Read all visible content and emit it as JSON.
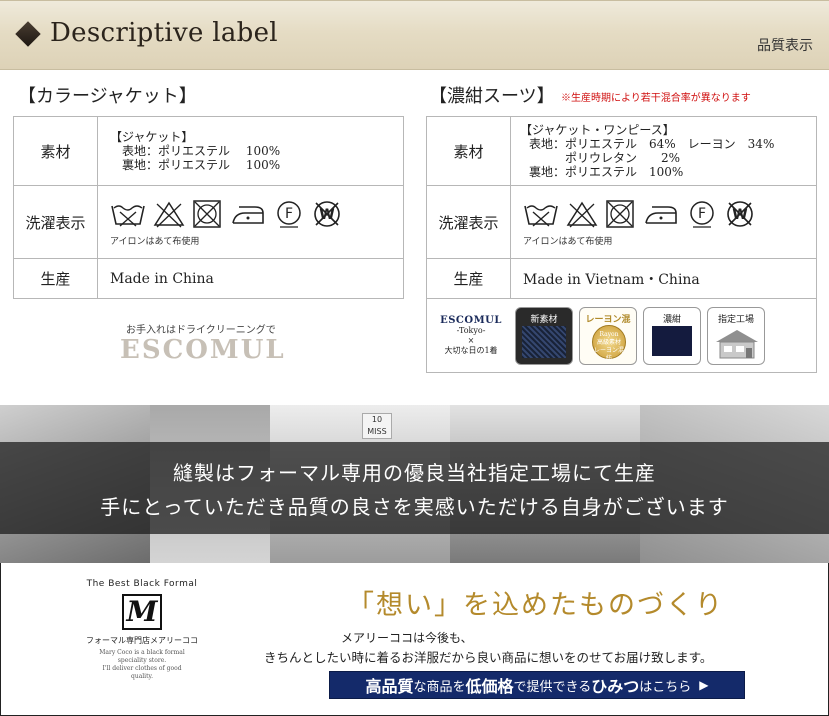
{
  "header": {
    "title": "Descriptive label",
    "subtitle": "品質表示"
  },
  "left": {
    "section_title": "【カラージャケット】",
    "rows": {
      "material_label": "素材",
      "material_head": "【ジャケット】",
      "material_lines": [
        "表地：ポリエステル　 100%",
        "裏地：ポリエステル　 100%"
      ],
      "care_label": "洗濯表示",
      "care_caption": "アイロンはあて布使用",
      "production_label": "生産",
      "production_value": "Made in China"
    },
    "cleaning_note": "お手入れはドライクリーニングで",
    "logo": "ESCOMUL"
  },
  "right": {
    "section_title": "【濃紺スーツ】",
    "note": "※生産時期により若干混合率が異なります",
    "rows": {
      "material_label": "素材",
      "material_head": "【ジャケット・ワンピース】",
      "material_lines": [
        "表地：ポリエステル　64%　レーヨン　34%",
        "　　　ポリウレタン　　2%",
        "裏地：ポリエステル　100%"
      ],
      "care_label": "洗濯表示",
      "care_caption": "アイロンはあて布使用",
      "production_label": "生産",
      "production_value": "Made in Vietnam・China"
    },
    "badges": {
      "brand_line1": "ESCOMUL",
      "brand_line2": "-Tokyo-",
      "brand_line3": "×",
      "brand_line4": "大切な日の1着",
      "new_material": "新素材",
      "rayon_mix": "レーヨン混",
      "rayon_medal_1": "Rayon",
      "rayon_medal_2": "高級素材",
      "rayon_medal_3": "レーヨン混紡",
      "navy": "濃紺",
      "factory": "指定工場"
    }
  },
  "banner": {
    "line1": "縫製はフォーマル専用の優良当社指定工場にて生産",
    "line2": "手にとっていただき品質の良さを実感いただける自身がございます",
    "photo_sign": "10 MISS"
  },
  "bottom": {
    "brand_tag": "The Best Black Formal",
    "brand_logo": "M",
    "brand_jp": "フォーマル専門店メアリーココ",
    "brand_en_1": "Mary Coco is a black formal",
    "brand_en_2": "speciality store.",
    "brand_en_3": "I'll deliver clothes of good",
    "brand_en_4": "quality.",
    "heading": "「想い」を込めたものづくり",
    "message1": "メアリーココは今後も、",
    "message2": "きちんとしたい時に着るお洋服だから良い商品に想いをのせてお届け致します。",
    "cta_part1": "高品質",
    "cta_part2": "な商品を",
    "cta_part3": "低価格",
    "cta_part4": "で提供できる",
    "cta_part5": "ひみつ",
    "cta_part6": "はこちら",
    "cta_arrow": "▶"
  }
}
